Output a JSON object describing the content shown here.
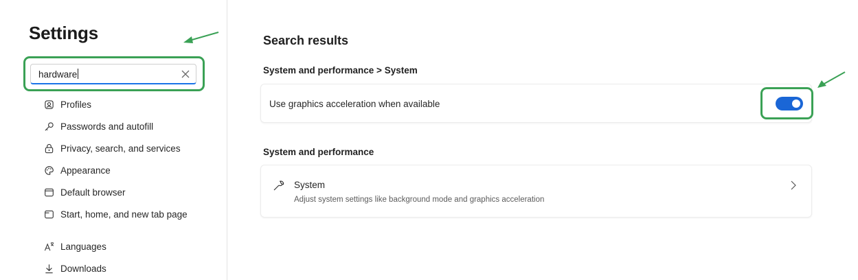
{
  "sidebar": {
    "title": "Settings",
    "search": {
      "value": "hardware",
      "clear_icon": "close-icon"
    },
    "items": [
      {
        "label": "Profiles",
        "icon": "profile-icon"
      },
      {
        "label": "Passwords and autofill",
        "icon": "key-icon"
      },
      {
        "label": "Privacy, search, and services",
        "icon": "lock-icon"
      },
      {
        "label": "Appearance",
        "icon": "palette-icon"
      },
      {
        "label": "Default browser",
        "icon": "browser-icon"
      },
      {
        "label": "Start, home, and new tab page",
        "icon": "home-tab-icon"
      },
      {
        "label": "Languages",
        "icon": "languages-icon"
      },
      {
        "label": "Downloads",
        "icon": "download-icon"
      }
    ]
  },
  "main": {
    "title": "Search results",
    "sections": [
      {
        "breadcrumb": "System and performance  >  System",
        "setting": {
          "label": "Use graphics acceleration when available",
          "enabled": true
        }
      },
      {
        "heading": "System and performance",
        "link": {
          "title": "System",
          "description": "Adjust system settings like background mode and graphics acceleration",
          "icon": "wrench-icon"
        }
      }
    ]
  },
  "annotations": {
    "highlight_color": "#3aa155",
    "accent_color": "#1a66d6"
  }
}
